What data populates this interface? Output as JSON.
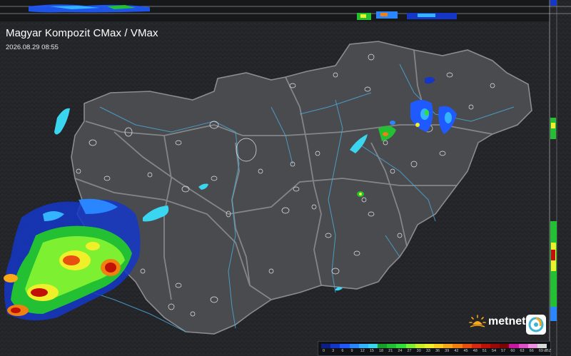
{
  "header": {
    "title": "Magyar Kompozit CMax / VMax",
    "timestamp": "2026.08.29 08:55"
  },
  "logo": {
    "text": "metnet",
    "icon": "sun-icon",
    "badge_icon": "swirl-icon"
  },
  "legend": {
    "unit": "dBZ",
    "labels": [
      "0",
      "3",
      "6",
      "9",
      "12",
      "15",
      "18",
      "21",
      "24",
      "27",
      "30",
      "33",
      "36",
      "39",
      "42",
      "45",
      "48",
      "51",
      "54",
      "57",
      "60",
      "63",
      "66",
      "69"
    ],
    "colors": [
      "#0a1e8c",
      "#1437c8",
      "#1e5aff",
      "#2a86ff",
      "#34b4ff",
      "#3ad6f0",
      "#18a02a",
      "#22c032",
      "#30e038",
      "#7ef032",
      "#c8f028",
      "#f0f02a",
      "#f8d020",
      "#f8a818",
      "#f08010",
      "#e85010",
      "#d82810",
      "#c01008",
      "#9c0808",
      "#7c0404",
      "#c818a0",
      "#e050c8",
      "#f090e0",
      "#d8d8d8"
    ]
  },
  "map": {
    "background": "#1e1f21",
    "country_fill": "#4a4b4e",
    "lake_color": "#3ad6f0",
    "river_color": "#4aa8d8",
    "border_color": "#8a8c90"
  }
}
